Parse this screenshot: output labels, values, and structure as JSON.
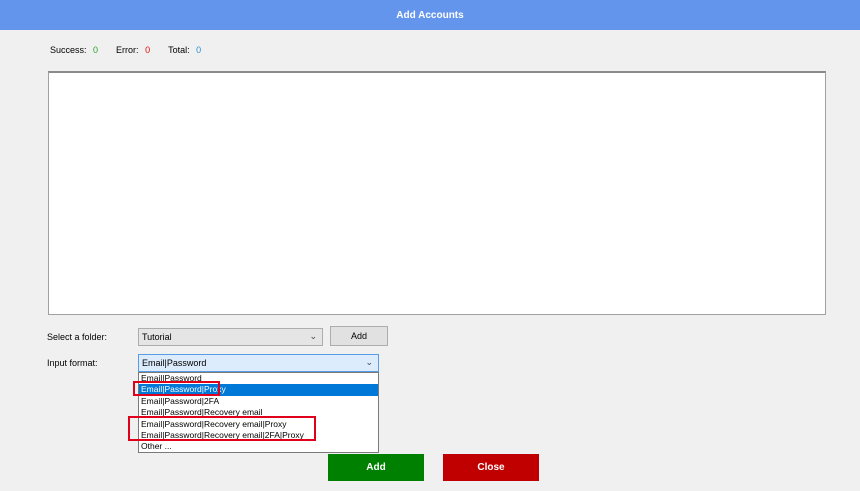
{
  "window": {
    "title": "Add Accounts"
  },
  "stats": {
    "success_label": "Success:",
    "success_value": "0",
    "error_label": "Error:",
    "error_value": "0",
    "total_label": "Total:",
    "total_value": "0"
  },
  "colors": {
    "titlebar": "#6495ed",
    "success": "#2aa52a",
    "error": "#e01010",
    "total": "#2d8fd5",
    "add_button": "#008000",
    "close_button": "#c00000",
    "selected_option": "#0078d7",
    "highlight": "#e0001b"
  },
  "folder": {
    "label": "Select a folder:",
    "value": "Tutorial",
    "add_label": "Add"
  },
  "input_format": {
    "label": "Input format:",
    "value": "Email|Password",
    "options": [
      "Email|Password",
      "Email|Password|Proxy",
      "Email|Password|2FA",
      "Email|Password|Recovery email",
      "Email|Password|Recovery email|Proxy",
      "Email|Password|Recovery email|2FA|Proxy",
      "Other ..."
    ],
    "selected_option": "Email|Password|Proxy"
  },
  "buttons": {
    "add": "Add",
    "close": "Close"
  }
}
